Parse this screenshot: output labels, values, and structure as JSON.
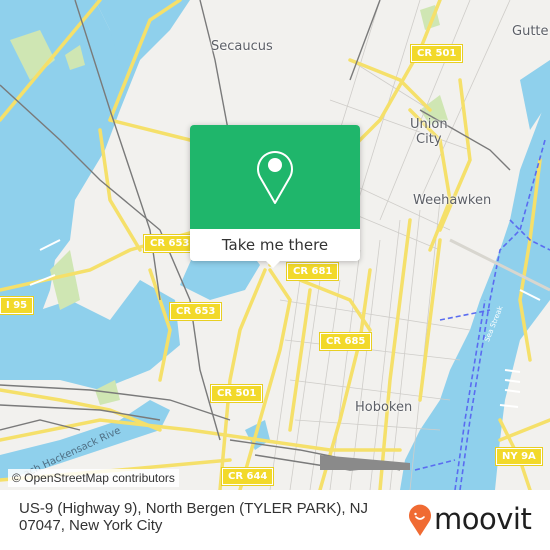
{
  "map": {
    "colors": {
      "land": "#f2f1ee",
      "water": "#8fd0ec",
      "park": "#cfe6b3",
      "major_road": "#f5e06a",
      "minor_road": "#c9c7c3",
      "rail": "#777777",
      "ferry": "#5a6cf0"
    },
    "places": [
      {
        "name": "Secaucus"
      },
      {
        "name": "Gutte"
      },
      {
        "name": "Union\nCity"
      },
      {
        "name": "Weehawken"
      },
      {
        "name": "Hoboken"
      }
    ],
    "road_shields": [
      {
        "label": "CR 501"
      },
      {
        "label": "CR 653"
      },
      {
        "label": "CR 681"
      },
      {
        "label": "I 95"
      },
      {
        "label": "CR 653"
      },
      {
        "label": "CR 685"
      },
      {
        "label": "CR 501"
      },
      {
        "label": "NY 9A"
      },
      {
        "label": "CR 644"
      }
    ],
    "river_label": "ach Hackensack Rive",
    "ferry_label": "Sea Streak",
    "attribution": "© OpenStreetMap contributors"
  },
  "popup": {
    "icon": "location-pin-icon",
    "cta_label": "Take me there",
    "color": "#1fb66b"
  },
  "footer": {
    "address": "US-9 (Highway 9), North Bergen (TYLER PARK), NJ 07047, New York City",
    "logo_text": "moovit",
    "logo_color": "#f06b33"
  }
}
